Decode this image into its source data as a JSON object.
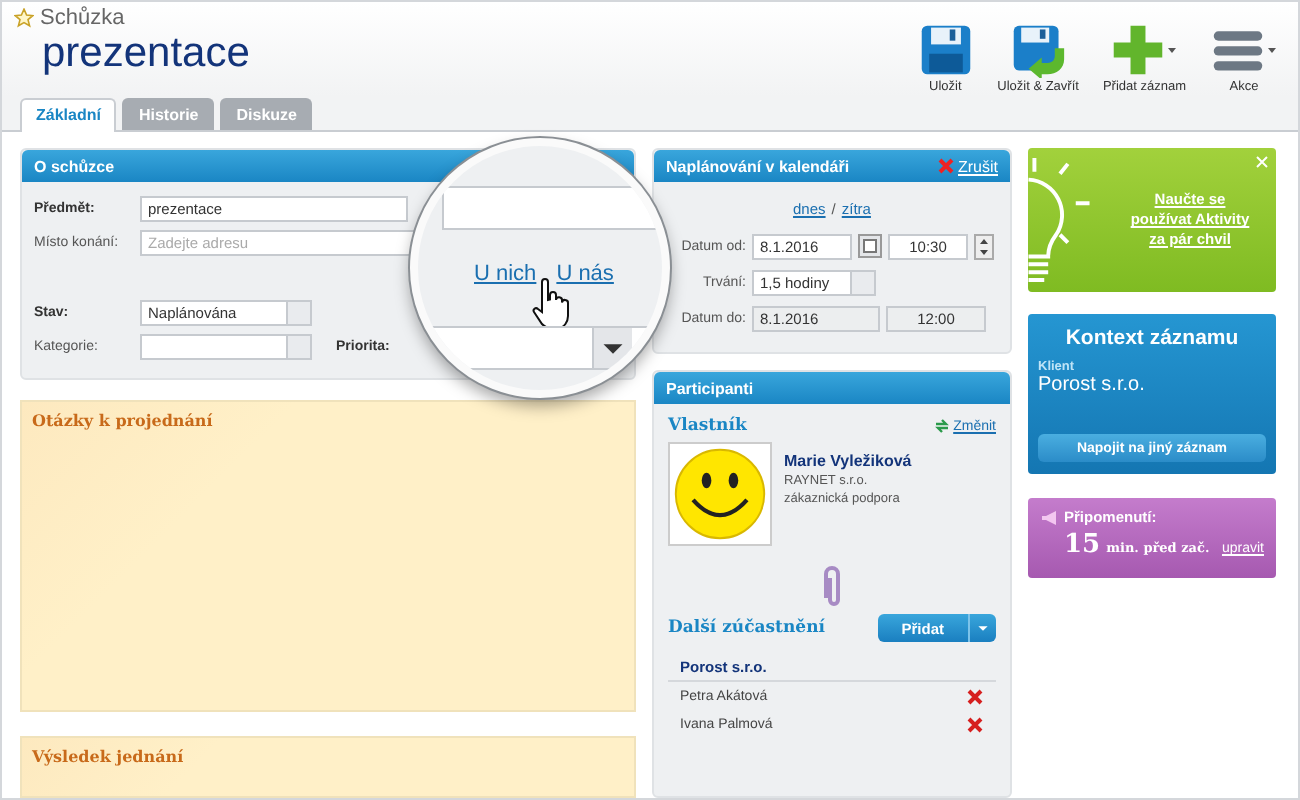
{
  "header": {
    "module": "Schůzka",
    "title": "prezentace"
  },
  "toolbar": [
    {
      "kind": "save",
      "label": "Uložit",
      "menu": false
    },
    {
      "kind": "save_close",
      "label": "Uložit & Zavřít",
      "menu": false
    },
    {
      "kind": "add",
      "label": "Přidat záznam",
      "menu": true
    },
    {
      "kind": "actions",
      "label": "Akce",
      "menu": true
    }
  ],
  "tabs": [
    {
      "label": "Základní",
      "selected": true
    },
    {
      "label": "Historie",
      "selected": false
    },
    {
      "label": "Diskuze",
      "selected": false
    }
  ],
  "meeting": {
    "title": "O schůzce",
    "subject": {
      "label": "Předmět:",
      "value": "prezentace"
    },
    "place": {
      "label": "Místo konání:",
      "placeholder": "Zadejte adresu"
    },
    "status": {
      "label": "Stav:",
      "value": "Naplánována"
    },
    "category": {
      "label": "Kategorie:"
    },
    "priority": {
      "label": "Priorita:"
    }
  },
  "magnifier": {
    "links": [
      "U nich",
      "U nás"
    ]
  },
  "notes": [
    {
      "title": "Otázky k projednání"
    },
    {
      "title": "Výsledek jednání"
    }
  ],
  "schedule": {
    "title": "Naplánování v kalendáři",
    "cancel": "Zrušit",
    "quick_links": [
      "dnes",
      "zítra"
    ],
    "separator": "/",
    "rows": [
      {
        "kind": "datetime",
        "label": "Datum od:",
        "date": "8.1.2016",
        "time": "10:30",
        "disabled": false
      },
      {
        "kind": "select",
        "label": "Trvání:",
        "value": "1,5 hodiny"
      },
      {
        "kind": "datetime",
        "label": "Datum do:",
        "date": "8.1.2016",
        "time": "12:00",
        "disabled": true
      }
    ]
  },
  "participants": {
    "title": "Participanti",
    "owner_heading": "Vlastník",
    "change": "Změnit",
    "owner": {
      "name": "Marie Vyležiková",
      "company": "RAYNET s.r.o.",
      "role": "zákaznická podpora"
    },
    "others_heading": "Další zúčastnění",
    "add": "Přidat",
    "groups": [
      {
        "name": "Porost s.r.o.",
        "people": [
          "Petra Akátová",
          "Ivana Palmová"
        ]
      }
    ]
  },
  "tip": {
    "text": "Naučte se používat Aktivity za pár chvil"
  },
  "context": {
    "title": "Kontext záznamu",
    "client_label": "Klient",
    "client": "Porost s.r.o.",
    "button": "Napojit na jiný záznam"
  },
  "reminder": {
    "label": "Připomenutí:",
    "amount": "15",
    "unit": "min. před zač.",
    "edit": "upravit"
  }
}
